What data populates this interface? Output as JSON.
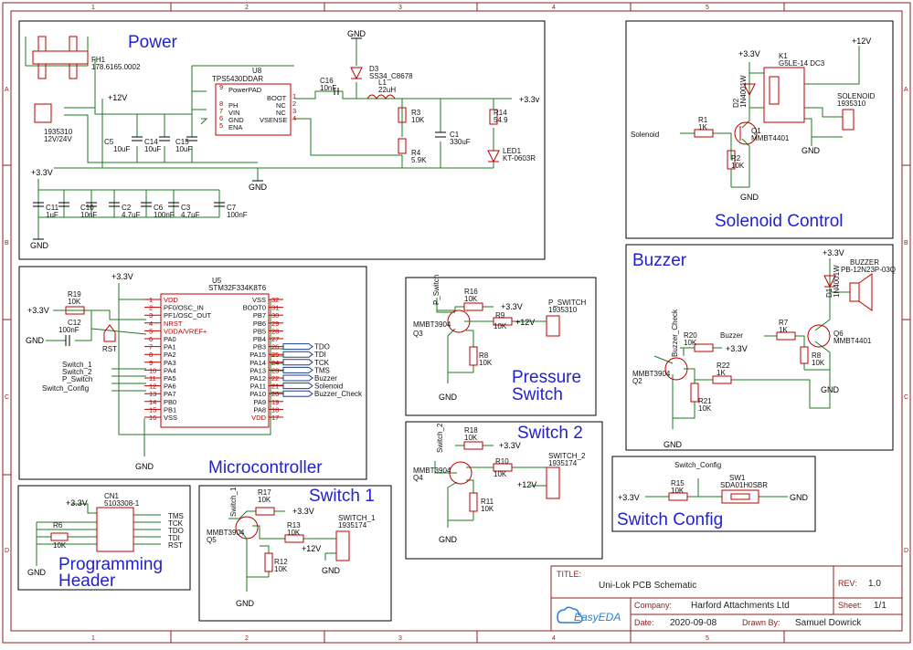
{
  "sections": {
    "power": "Power",
    "solenoid": "Solenoid Control",
    "buzzer": "Buzzer",
    "microcontroller": "Microcontroller",
    "pressure": [
      "Pressure",
      "Switch"
    ],
    "switch2": "Switch 2",
    "switch1": "Switch 1",
    "switch_config": "Switch Config",
    "prog": [
      "Programming",
      "Header"
    ]
  },
  "nets": {
    "gnd": "GND",
    "v33": "+3.3V",
    "v33_lower": "+3.3v",
    "v12": "+12V",
    "solenoid": "Solenoid",
    "buzzer": "Buzzer",
    "switch_config": "Switch_Config",
    "switch_1": "Switch_1",
    "switch_2": "Switch_2",
    "p_switch": "P_Switch",
    "buzzer_check": "Buzzer_Check",
    "tms": "TMS",
    "tck": "TCK",
    "tdo": "TDO",
    "tdi": "TDI",
    "rst": "RST"
  },
  "power": {
    "fh1": [
      "FH1",
      "178.6165.0002"
    ],
    "u8": [
      "U8",
      "TPS5430DDAR"
    ],
    "u8_pins": [
      "PowerPAD",
      "PH",
      "VIN",
      "GND",
      "ENA",
      "BOOT",
      "NC",
      "NC",
      "VSENSE"
    ],
    "u8_nums": [
      "9",
      "8",
      "7",
      "6",
      "5",
      "1",
      "2",
      "3",
      "4"
    ],
    "conn": [
      "1935310",
      "12V/24V"
    ],
    "caps_in": [
      [
        "C5",
        "10uF"
      ],
      [
        "C14",
        "10uF"
      ],
      [
        "C15",
        "10uF"
      ]
    ],
    "c16": [
      "C16",
      "10nF"
    ],
    "d3": [
      "D3",
      "SS34_C8678"
    ],
    "l1": [
      "L1",
      "22uH"
    ],
    "r3": [
      "R3",
      "10K"
    ],
    "r4": [
      "R4",
      "5.9K"
    ],
    "c1": [
      "C1",
      "330uF"
    ],
    "r14": [
      "R14",
      "54.9"
    ],
    "led1": [
      "LED1",
      "KT-0603R"
    ],
    "decoup": [
      [
        "C11",
        "1uF"
      ],
      [
        "C10",
        "10nF"
      ],
      [
        "C2",
        "4.7uF"
      ],
      [
        "C6",
        "100nF"
      ],
      [
        "C3",
        "4.7uF"
      ],
      [
        "C7",
        "100nF"
      ]
    ]
  },
  "solenoid": {
    "k1": [
      "K1",
      "G5LE-14 DC3"
    ],
    "d2": [
      "D2",
      "1N4001W"
    ],
    "r1": [
      "R1",
      "1K"
    ],
    "r2": [
      "R2",
      "10K"
    ],
    "q1": [
      "Q1",
      "MMBT4401"
    ],
    "conn": [
      "SOLENOID",
      "1935310"
    ]
  },
  "buzzer": {
    "bz": [
      "BUZZER",
      "PB-12N23P-03Q"
    ],
    "d1": [
      "D1",
      "1N4001W"
    ],
    "r7": [
      "R7",
      "1K"
    ],
    "r8": [
      "R8",
      "10K"
    ],
    "q6": [
      "Q6",
      "MMBT4401"
    ],
    "r20": [
      "R20",
      "10K"
    ],
    "r22": [
      "R22",
      "1K"
    ],
    "r21": [
      "R21",
      "10K"
    ],
    "q2": [
      "MMBT3904",
      "Q2"
    ]
  },
  "mcu": {
    "u5": [
      "U5",
      "STM32F334K8T6"
    ],
    "left_pins": [
      "VDD",
      "PF0/OSC_IN",
      "PF1/OSC_OUT",
      "NRST",
      "VDDA/VREF+",
      "PA0",
      "PA1",
      "PA2",
      "PA3",
      "PA4",
      "PA5",
      "PA6",
      "PA7",
      "PB0",
      "PB1",
      "VSS"
    ],
    "left_nums": [
      "1",
      "2",
      "3",
      "4",
      "5",
      "6",
      "7",
      "8",
      "9",
      "10",
      "11",
      "12",
      "13",
      "14",
      "15",
      "16"
    ],
    "right_pins": [
      "VSS",
      "BOOT0",
      "PB7",
      "PB6",
      "PB5",
      "PB4",
      "PB3",
      "PA15",
      "PA14",
      "PA13",
      "PA12",
      "PA11",
      "PA10",
      "PA9",
      "PA8",
      "VDD"
    ],
    "right_nums": [
      "32",
      "31",
      "30",
      "29",
      "28",
      "27",
      "26",
      "25",
      "24",
      "23",
      "22",
      "21",
      "20",
      "19",
      "18",
      "17"
    ],
    "r19": [
      "R19",
      "10K"
    ],
    "c12": [
      "C12",
      "100nF"
    ],
    "right_nets": [
      "TDO",
      "TDI",
      "TCK",
      "TMS",
      "Buzzer",
      "Solenoid",
      "Buzzer_Check"
    ]
  },
  "pressure": {
    "r16": [
      "R16",
      "10K"
    ],
    "r9": [
      "R9",
      "10K"
    ],
    "r8": [
      "R8",
      "10K"
    ],
    "q3": [
      "MMBT3904",
      "Q3"
    ],
    "conn": [
      "P_SWITCH",
      "1935310"
    ]
  },
  "switch2": {
    "r18": [
      "R18",
      "10K"
    ],
    "r10": [
      "R10",
      "10K"
    ],
    "r11": [
      "R11",
      "10K"
    ],
    "q4": [
      "MMBT3904",
      "Q4"
    ],
    "conn": [
      "SWITCH_2",
      "1935174"
    ]
  },
  "switch1": {
    "r17": [
      "R17",
      "10K"
    ],
    "r13": [
      "R13",
      "10K"
    ],
    "r12": [
      "R12",
      "10K"
    ],
    "q5": [
      "MMBT3904",
      "Q5"
    ],
    "conn": [
      "SWITCH_1",
      "1935174"
    ]
  },
  "switch_config": {
    "r15": [
      "R15",
      "10K"
    ],
    "sw1": [
      "SW1",
      "SDA01H0SBR"
    ]
  },
  "prog": {
    "cn1": [
      "CN1",
      "5103308-1"
    ],
    "r6": [
      "R6",
      "10K"
    ]
  },
  "title_block": {
    "title_label": "TITLE:",
    "title": "Uni-Lok PCB Schematic",
    "rev_label": "REV:",
    "rev": "1.0",
    "company_label": "Company:",
    "company": "Harford Attachments Ltd",
    "sheet_label": "Sheet:",
    "sheet": "1/1",
    "date_label": "Date:",
    "date": "2020-09-08",
    "drawn_label": "Drawn By:",
    "drawn": "Samuel Dowrick",
    "logo": "EasyEDA"
  },
  "zones": {
    "cols": [
      "1",
      "2",
      "3",
      "4",
      "5"
    ],
    "rows": [
      "A",
      "B",
      "C",
      "D"
    ]
  },
  "colors": {
    "wire": "#1f7a1f",
    "section": "#2222cc",
    "part": "#b00000",
    "border": "#8b2020"
  }
}
